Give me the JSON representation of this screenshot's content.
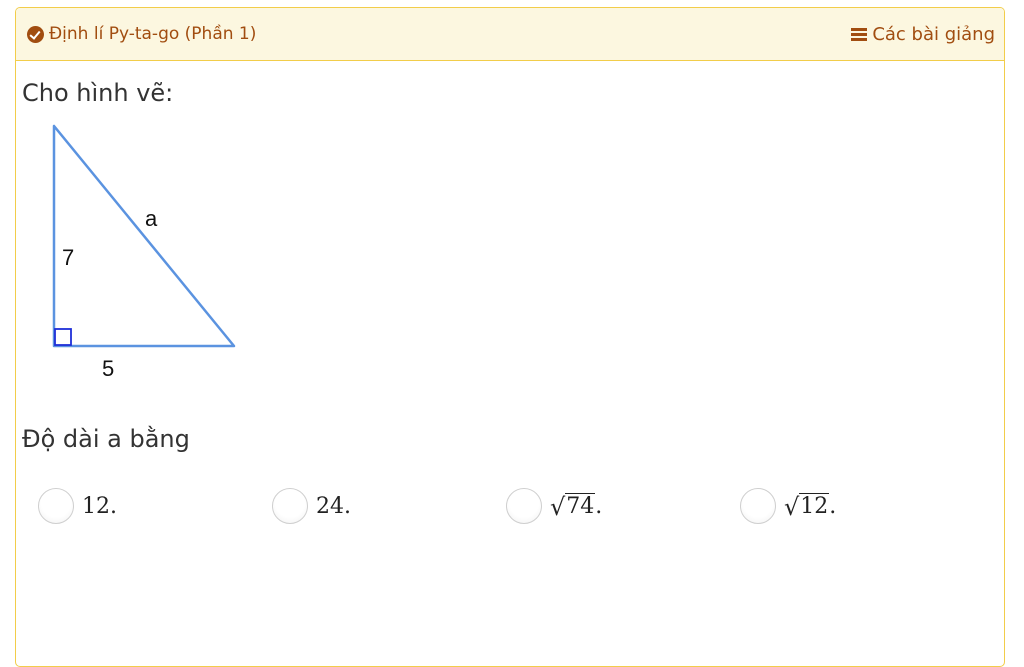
{
  "header": {
    "lesson_title": "Định lí Py-ta-go (Phần 1)",
    "lessons_link": "Các bài giảng"
  },
  "question": {
    "intro": "Cho hình vẽ:",
    "prompt": "Độ dài a bằng"
  },
  "figure": {
    "label_hypotenuse": "a",
    "label_vertical": "7",
    "label_horizontal": "5"
  },
  "options": [
    {
      "text": "12.",
      "radical": false
    },
    {
      "text": "24.",
      "radical": false
    },
    {
      "text": "74",
      "suffix": ".",
      "radical": true
    },
    {
      "text": "12",
      "suffix": ".",
      "radical": true
    }
  ],
  "colors": {
    "accent": "#a14d10",
    "header_bg": "#fcf7e0",
    "border": "#f2cd4a",
    "triangle": "#5b93e0",
    "right_angle_marker": "#1f2fd8"
  },
  "icons": {
    "header_left": "check-circle-icon",
    "header_right": "bars-icon"
  }
}
